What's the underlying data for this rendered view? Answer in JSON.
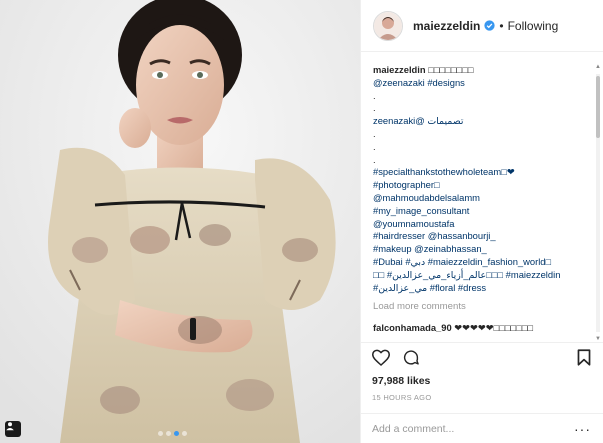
{
  "post": {
    "username": "maiezzeldin",
    "following_label": "Following",
    "separator": "•"
  },
  "caption": {
    "line1_user": "maiezzeldin",
    "line1_text": "□□□□□□□□",
    "lines": [
      {
        "kind": "link",
        "text": "@zeenazaki #designs"
      },
      {
        "kind": "plain",
        "text": "."
      },
      {
        "kind": "plain",
        "text": "."
      },
      {
        "kind": "rtl",
        "text": "تصميمات @zeenazaki"
      },
      {
        "kind": "plain",
        "text": "."
      },
      {
        "kind": "plain",
        "text": "."
      },
      {
        "kind": "plain",
        "text": "."
      },
      {
        "kind": "link",
        "text": "#specialthankstothewholeteam□❤"
      },
      {
        "kind": "link",
        "text": "#photographer□"
      },
      {
        "kind": "link",
        "text": "@mahmoudabdelsalamm"
      },
      {
        "kind": "link",
        "text": "#my_image_consultant"
      },
      {
        "kind": "link",
        "text": "@youmnamoustafa"
      },
      {
        "kind": "link",
        "text": "#hairdresser @hassanbourji_"
      },
      {
        "kind": "link",
        "text": "#makeup @zeinabhassan_"
      },
      {
        "kind": "link",
        "text": "#Dubai #دبي #maiezzeldin_fashion_world□"
      },
      {
        "kind": "link",
        "text": "□□ #عالم_أزياء_مي_عزالدين□□□ #maiezzeldin"
      },
      {
        "kind": "link",
        "text": "#مي_عزالدين #floral #dress"
      }
    ]
  },
  "load_more": "Load more comments",
  "comment": {
    "user": "falconhamada_90",
    "text": "❤❤❤❤❤□□□□□□□"
  },
  "likes": "97,988 likes",
  "timestamp": "15 HOURS AGO",
  "add_comment_placeholder": "Add a comment...",
  "more_label": "···",
  "colors": {
    "link": "#003569",
    "verified": "#3897f0",
    "dot_active": "#3897f0",
    "muted": "#999999"
  },
  "icons": [
    "heart-icon",
    "comment-icon",
    "bookmark-icon",
    "verified-badge-icon",
    "tag-person-icon",
    "more-options-icon"
  ],
  "carousel": {
    "count": 4,
    "active_index": 2
  }
}
